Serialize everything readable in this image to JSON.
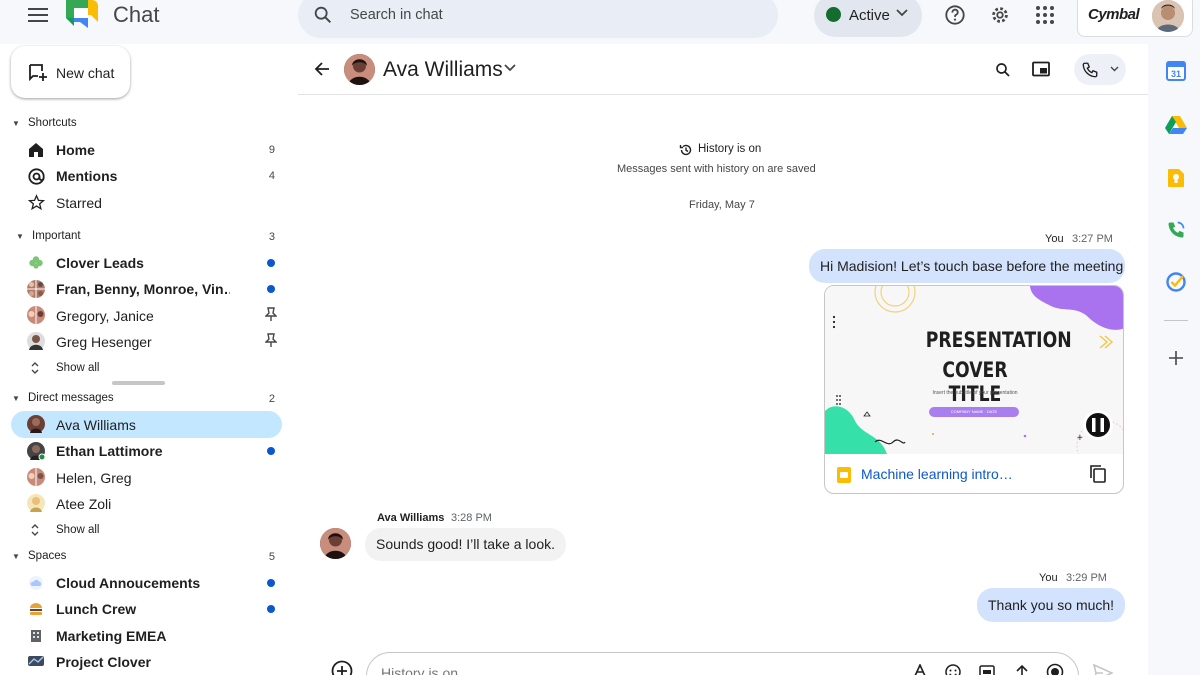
{
  "app": {
    "title": "Chat"
  },
  "search": {
    "placeholder": "Search in chat"
  },
  "status": {
    "label": "Active",
    "color": "#146c2e"
  },
  "account": {
    "brand": "Cymbal"
  },
  "sidebar": {
    "new_chat": "New chat",
    "shortcuts": {
      "title": "Shortcuts",
      "items": [
        {
          "label": "Home",
          "count": "9",
          "icon": "home-icon"
        },
        {
          "label": "Mentions",
          "count": "4",
          "icon": "at-icon"
        },
        {
          "label": "Starred",
          "count": "",
          "icon": "star-icon"
        }
      ]
    },
    "important": {
      "title": "Important",
      "count": "3",
      "items": [
        {
          "label": "Clover Leads",
          "status": "unread"
        },
        {
          "label": "Fran, Benny, Monroe, Vin…",
          "status": "unread"
        },
        {
          "label": "Gregory, Janice",
          "status": "pinned"
        },
        {
          "label": "Greg Hesenger",
          "status": "pinned"
        }
      ],
      "show_all": "Show all"
    },
    "direct_messages": {
      "title": "Direct messages",
      "count": "2",
      "items": [
        {
          "label": "Ava Williams",
          "status": "selected"
        },
        {
          "label": "Ethan Lattimore",
          "status": "unread"
        },
        {
          "label": "Helen, Greg",
          "status": ""
        },
        {
          "label": "Atee Zoli",
          "status": ""
        }
      ],
      "show_all": "Show all"
    },
    "spaces": {
      "title": "Spaces",
      "count": "5",
      "items": [
        {
          "label": "Cloud Annoucements",
          "status": "unread"
        },
        {
          "label": "Lunch Crew",
          "status": "unread"
        },
        {
          "label": "Marketing EMEA",
          "status": ""
        },
        {
          "label": "Project Clover",
          "status": ""
        }
      ]
    }
  },
  "conversation": {
    "name": "Ava Williams",
    "history_title": "History is on",
    "history_sub": "Messages sent with history on are saved",
    "date": "Friday, May 7",
    "messages": [
      {
        "sender": "You",
        "time": "3:27 PM",
        "text": "Hi Madision! Let’s touch base before the meeting"
      },
      {
        "sender": "Ava Williams",
        "time": "3:28 PM",
        "text": "Sounds good! I’ll take a look."
      },
      {
        "sender": "You",
        "time": "3:29 PM",
        "text": "Thank you so much!"
      }
    ],
    "attachment": {
      "slide_title_line1": "PRESENTATION",
      "slide_title_line2": "COVER TITLE",
      "slide_subtitle": "Insert the sub title of your presentation",
      "slide_pill": "COMPANY NAME · DATE",
      "file_name": "Machine learning intro…"
    }
  },
  "composer": {
    "placeholder": "History is on"
  },
  "colors": {
    "accent": "#0b57d0",
    "selected": "#c2e7ff",
    "outgoing_bubble": "#d3e3fd"
  }
}
